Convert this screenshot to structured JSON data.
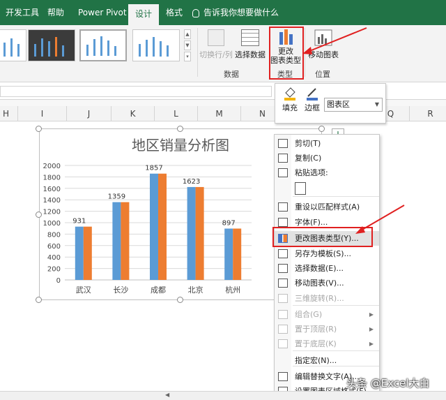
{
  "ribbon_tabs": [
    {
      "label": "开发工具"
    },
    {
      "label": "帮助"
    },
    {
      "label": "Power Pivot"
    },
    {
      "label": "设计"
    },
    {
      "label": "格式"
    }
  ],
  "tell_me": "告诉我你想要做什么",
  "ribbon": {
    "switch_rowcol": "切换行/列",
    "select_data": "选择数据",
    "data_group": "数据",
    "change_type_line1": "更改",
    "change_type_line2": "图表类型",
    "type_group": "类型",
    "move_chart": "移动图表",
    "location_group": "位置"
  },
  "columns": [
    "H",
    "I",
    "J",
    "K",
    "L",
    "M",
    "N",
    "",
    "Q",
    "R"
  ],
  "mini_toolbar": {
    "fill": "填充",
    "outline": "边框",
    "element_select": "图表区"
  },
  "chart_data": {
    "type": "bar",
    "title": "地区销量分析图",
    "categories": [
      "武汉",
      "长沙",
      "成都",
      "北京",
      "杭州"
    ],
    "series": [
      {
        "values": [
          931,
          1359,
          1857,
          1623,
          897
        ],
        "color": "#5b9bd5"
      },
      {
        "values": [
          931,
          1359,
          1857,
          1623,
          897
        ],
        "color": "#ed7d31"
      }
    ],
    "data_labels": [
      "931",
      "1359",
      "1857",
      "1623",
      "897"
    ],
    "y_ticks": [
      "0",
      "200",
      "400",
      "600",
      "800",
      "1000",
      "1200",
      "1400",
      "1600",
      "1800",
      "2000"
    ],
    "ylim": [
      0,
      2000
    ],
    "grid": true
  },
  "context_menu": {
    "items": [
      {
        "label": "剪切(T)",
        "icon": "scissors-icon",
        "disabled": false
      },
      {
        "label": "复制(C)",
        "icon": "copy-icon",
        "disabled": false
      },
      {
        "label": "粘贴选项:",
        "icon": "paste-icon",
        "disabled": false
      },
      {
        "label": "",
        "icon": "paste-option-icon",
        "disabled": false
      },
      {
        "label": "重设以匹配样式(A)",
        "icon": "reset-style-icon",
        "disabled": false
      },
      {
        "label": "字体(F)...",
        "icon": "font-icon",
        "disabled": false
      },
      {
        "label": "更改图表类型(Y)...",
        "icon": "chart-type-icon",
        "disabled": false
      },
      {
        "label": "另存为模板(S)...",
        "icon": "save-template-icon",
        "disabled": false
      },
      {
        "label": "选择数据(E)...",
        "icon": "select-data-icon",
        "disabled": false
      },
      {
        "label": "移动图表(V)...",
        "icon": "move-chart-icon",
        "disabled": false
      },
      {
        "label": "三维旋转(R)...",
        "icon": "rotate-3d-icon",
        "disabled": true
      },
      {
        "label": "组合(G)",
        "icon": "group-icon",
        "disabled": true
      },
      {
        "label": "置于顶层(R)",
        "icon": "bring-front-icon",
        "disabled": true
      },
      {
        "label": "置于底层(K)",
        "icon": "send-back-icon",
        "disabled": true
      },
      {
        "label": "指定宏(N)...",
        "icon": "",
        "disabled": false
      },
      {
        "label": "编辑替换文字(A)...",
        "icon": "alt-text-icon",
        "disabled": false
      },
      {
        "label": "设置图表区域格式(F)...",
        "icon": "format-area-icon",
        "disabled": false
      }
    ]
  },
  "watermark": "头条 @Excel大白"
}
